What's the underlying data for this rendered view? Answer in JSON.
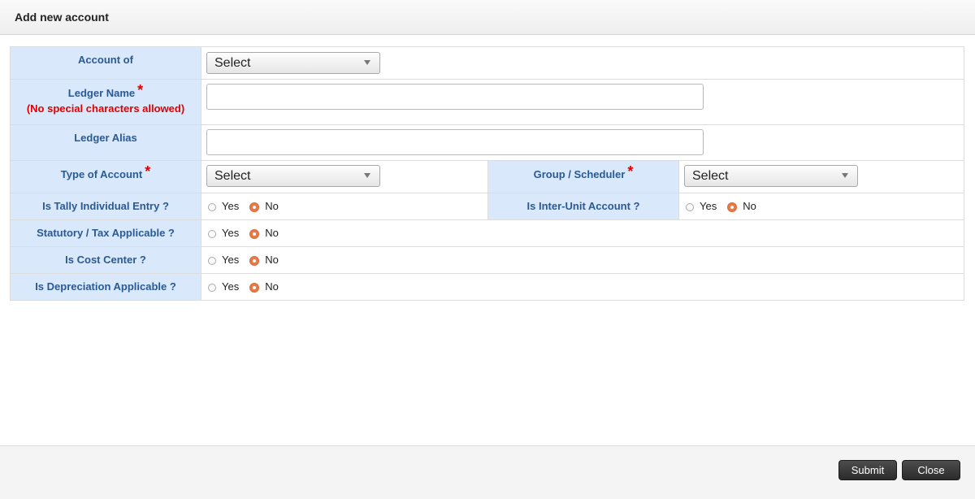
{
  "dialog": {
    "title": "Add new account"
  },
  "form": {
    "account_of": {
      "label": "Account of",
      "value": "Select"
    },
    "ledger_name": {
      "label": "Ledger Name",
      "required": "*",
      "note": "(No special characters allowed)",
      "value": ""
    },
    "ledger_alias": {
      "label": "Ledger Alias",
      "value": ""
    },
    "type_of_account": {
      "label": "Type of Account",
      "required": "*",
      "value": "Select"
    },
    "group_scheduler": {
      "label": "Group / Scheduler",
      "required": "*",
      "value": "Select"
    },
    "tally_individual": {
      "label": "Is Tally Individual Entry ?",
      "yes": "Yes",
      "no": "No",
      "selected": "No"
    },
    "inter_unit": {
      "label": "Is Inter-Unit Account ?",
      "yes": "Yes",
      "no": "No",
      "selected": "No"
    },
    "statutory_tax": {
      "label": "Statutory / Tax Applicable ?",
      "yes": "Yes",
      "no": "No",
      "selected": "No"
    },
    "cost_center": {
      "label": "Is Cost Center ?",
      "yes": "Yes",
      "no": "No",
      "selected": "No"
    },
    "depreciation": {
      "label": "Is Depreciation Applicable ?",
      "yes": "Yes",
      "no": "No",
      "selected": "No"
    }
  },
  "footer": {
    "submit_label": "Submit",
    "close_label": "Close"
  },
  "colors": {
    "label_bg": "#d9e8fb",
    "label_text": "#2a5a93",
    "required": "#e00000",
    "radio_checked": "#ea7a45"
  }
}
